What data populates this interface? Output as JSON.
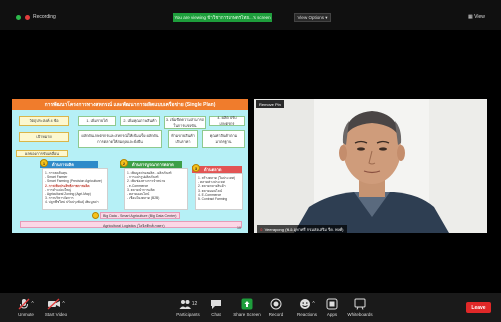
{
  "topbar": {
    "recording": "Recording",
    "banner": "You are viewing ข้าวิชาการเกษตรไทย...'s screen",
    "view_options": "View Options ▾",
    "view": "View"
  },
  "slide": {
    "title": "การพัฒนาโครงการทางสหกรณ์ และพัฒนาการผลิตแบบเครือข่าย (Single Plan)",
    "goal_label": "วัตถุประสงค์ 4 ข้อ",
    "boxes": [
      "1. เพิ่มรายได้",
      "2. เพิ่มคุณภาพสินค้า",
      "3. เพิ่มขีดความสามารถในการแข่งขัน",
      "4. ผลิต ปรับเกษตรกร"
    ],
    "target_label": "เป้าหมาย",
    "target_text": "ผลักดันเกษตรกรและสหกรณ์ให้เข้มแข็ง ผลักดันการตลาดให้สมดุลและยั่งยืน",
    "ministry_text": "ห้ามขายสินค้าเกินราคา",
    "ministry_text2": "คุณค่าสินค้าตามมาตรฐาน",
    "bottom_label": "ผลของการขับเคลื่อน",
    "col1": {
      "num": "1",
      "title": "ด้านการผลิต",
      "lines": [
        "1. การลดต้นทุน",
        "- Smart Farmer",
        "- Smart Farming (Precision Agriculture)",
        "2. การเพิ่มประสิทธิภาพการผลิต",
        "- การทำแปลงใหญ่",
        "- Agricultural Zoning (Agri-Map)",
        "3. การบริหารจัดการ",
        "4. ปลูกพืชใหม่ ปรับปรุงพันธุ์ เพิ่มมูลค่า"
      ]
    },
    "col2": {
      "num": "2",
      "title": "ด้านการบูรณาการตลาด",
      "lines": [
        "1. เพิ่มมูลค่าผลผลิต - ผลิตภัณฑ์",
        "- การแปรรูปผลิตภัณฑ์",
        "2. เพิ่มช่องทางการจำหน่าย",
        "- e-Commerce",
        "3. ตลาดนำการผลิต",
        "- ตลาดออนไลน์",
        "- เชื่อมโยงตลาด (B2B)"
      ]
    },
    "col3": {
      "num": "3",
      "title": "ด้านตลาด",
      "lines": [
        "1. สร้างตลาด (ในประเทศ)",
        "- ตลาดต่างประเทศ",
        "2. ตลาดกลางสินค้า",
        "3. ตลาดออนไลน์",
        "4. E-Commerce",
        "5. Contract Farming"
      ]
    },
    "big_data": "Big Data - Smart Agriculture (Big Data Center)",
    "logistics": "Agricultural Logistics (โลจิสติกส์เกษตร)",
    "page": "10"
  },
  "video": {
    "remove_pin": "Remove Pin",
    "name": "Veerapong (พ.อ.อุทาศรี กรมส่งเสริม รีด. พงศ์)"
  },
  "toolbar": {
    "items": [
      {
        "label": "Unmute",
        "icon": "microphone-muted-icon"
      },
      {
        "label": "Start Video",
        "icon": "video-off-icon"
      },
      {
        "label": "Participants",
        "icon": "participants-icon",
        "count": "12"
      },
      {
        "label": "Chat",
        "icon": "chat-icon"
      },
      {
        "label": "Share Screen",
        "icon": "share-screen-icon"
      },
      {
        "label": "Record",
        "icon": "record-icon"
      },
      {
        "label": "Reactions",
        "icon": "reactions-icon"
      },
      {
        "label": "Apps",
        "icon": "apps-icon"
      },
      {
        "label": "Whiteboards",
        "icon": "whiteboard-icon"
      }
    ],
    "leave": "Leave"
  },
  "colors": {
    "accent_green": "#1e9e3c",
    "leave_red": "#e02828",
    "slide_bg": "#b6f0f6",
    "slide_title": "#f07c2c"
  }
}
